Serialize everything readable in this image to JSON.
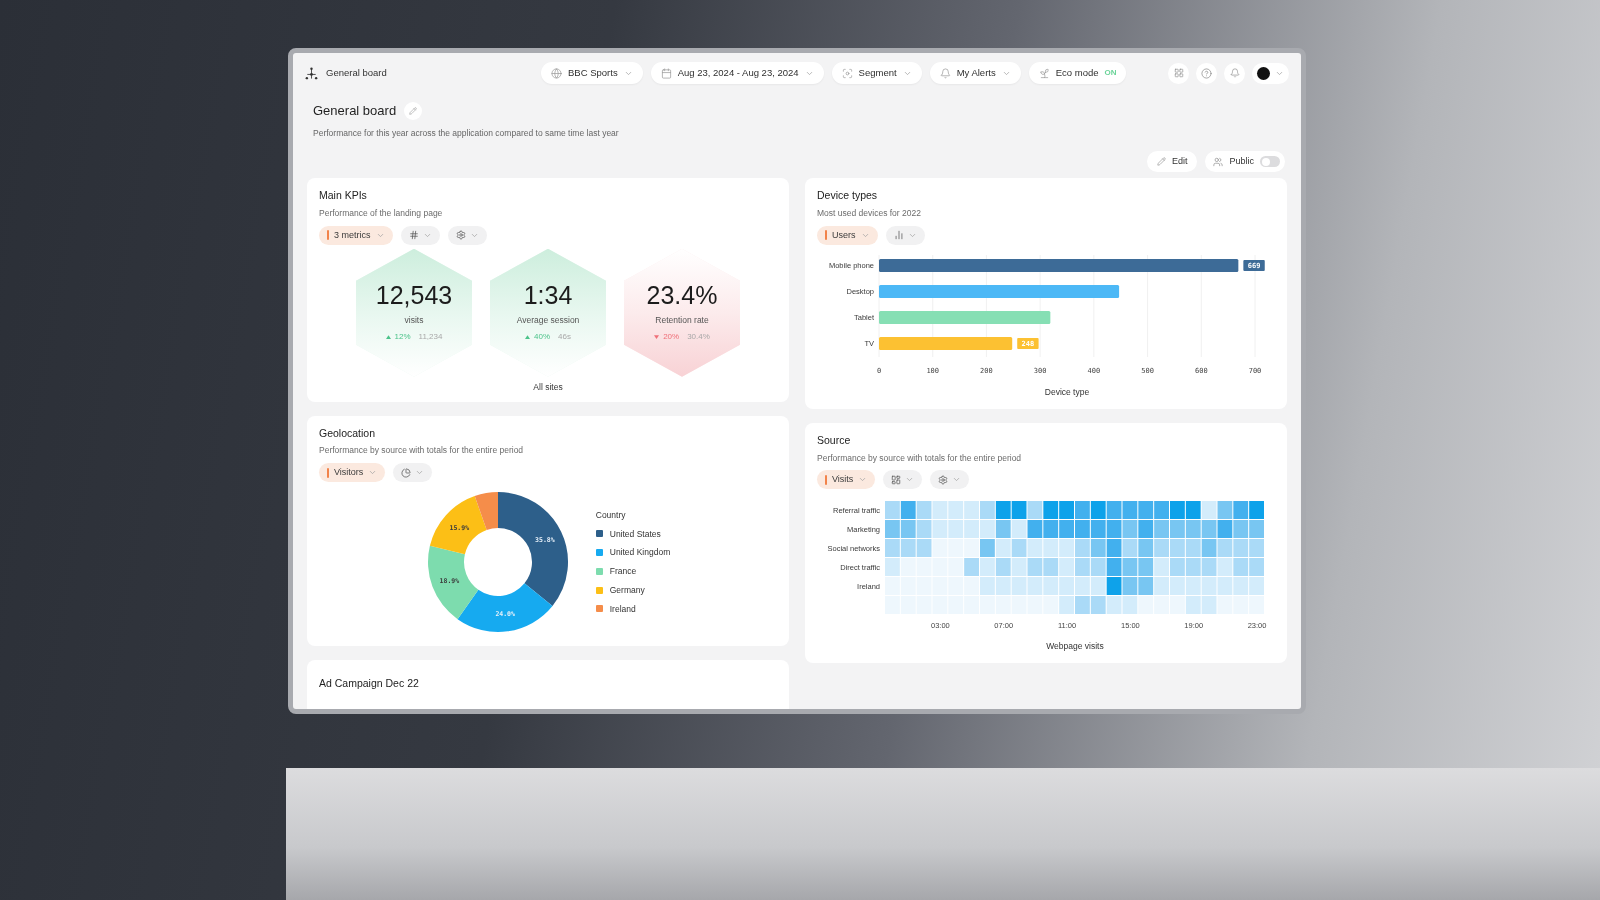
{
  "app": {
    "title": "General board"
  },
  "filters": [
    {
      "kind": "site",
      "label": "BBC Sports"
    },
    {
      "kind": "date",
      "label": "Aug 23, 2024 - Aug 23, 2024"
    },
    {
      "kind": "segment",
      "label": "Segment"
    },
    {
      "kind": "alerts",
      "label": "My Alerts"
    },
    {
      "kind": "eco",
      "label": "Eco mode",
      "status": "ON"
    }
  ],
  "page": {
    "title": "General board",
    "subtitle": "Performance for this year across the application compared to same time last year"
  },
  "actions": {
    "edit": "Edit",
    "public": {
      "label": "Public",
      "on": false
    }
  },
  "kpi_card": {
    "title": "Main KPIs",
    "subtitle": "Performance of the landing page",
    "controls": [
      {
        "kind": "metric",
        "label": "3 metrics"
      },
      {
        "kind": "format"
      },
      {
        "kind": "settings"
      }
    ],
    "kpis": [
      {
        "kind": "up",
        "value": "12,543",
        "label": "visits",
        "change": "12%",
        "previous": "11,234"
      },
      {
        "kind": "up",
        "value": "1:34",
        "label": "Average session",
        "change": "40%",
        "previous": "46s"
      },
      {
        "kind": "down",
        "value": "23.4%",
        "label": "Retention rate",
        "change": "20%",
        "previous": "30.4%"
      }
    ],
    "footer": "All sites"
  },
  "device_card": {
    "title": "Device types",
    "subtitle": "Most used devices for 2022",
    "controls": [
      {
        "kind": "metric",
        "label": "Users"
      },
      {
        "kind": "chart-type"
      }
    ],
    "chart_data": {
      "type": "bar",
      "orientation": "horizontal",
      "categories": [
        "Mobile phone",
        "Desktop",
        "Tablet",
        "TV"
      ],
      "values": [
        669,
        447,
        319,
        248
      ],
      "colors": [
        "#3d6b97",
        "#4cb8f6",
        "#86dfb4",
        "#fcc132"
      ],
      "xlabel": "Device type",
      "xlim": [
        0,
        700
      ],
      "xticks": [
        0,
        100,
        200,
        300,
        400,
        500,
        600,
        700
      ],
      "grid": true,
      "value_labels": [
        "669",
        null,
        null,
        "248"
      ]
    }
  },
  "geo_card": {
    "title": "Geolocation",
    "subtitle": "Performance by source with totals for the entire period",
    "controls": [
      {
        "kind": "metric",
        "label": "Visitors"
      },
      {
        "kind": "pie"
      }
    ],
    "chart_data": {
      "type": "donut",
      "legend_title": "Country",
      "categories": [
        "United States",
        "United Kingdom",
        "France",
        "Germany",
        "Ireland"
      ],
      "values": [
        35.8,
        24.0,
        18.9,
        15.9,
        5.4
      ],
      "colors": [
        "#2d5f8a",
        "#16aaf0",
        "#7ddcae",
        "#fcbf16",
        "#f58d4a"
      ],
      "value_labels": [
        "35.8%",
        "24.0%",
        "18.9%",
        "15.9%",
        null
      ]
    }
  },
  "source_card": {
    "title": "Source",
    "subtitle": "Performance by source with totals for the entire period",
    "controls": [
      {
        "kind": "metric",
        "label": "Visits"
      },
      {
        "kind": "layout"
      },
      {
        "kind": "settings"
      }
    ],
    "heatmap": {
      "rows": [
        "Referral traffic",
        "Marketing",
        "Social networks",
        "Direct traffic",
        "Ireland"
      ],
      "x_labels": [
        "03:00",
        "07:00",
        "11:00",
        "15:00",
        "19:00",
        "23:00"
      ],
      "xlabel": "Webpage visits"
    }
  },
  "campaign_card": {
    "title": "Ad Campaign Dec 22"
  }
}
